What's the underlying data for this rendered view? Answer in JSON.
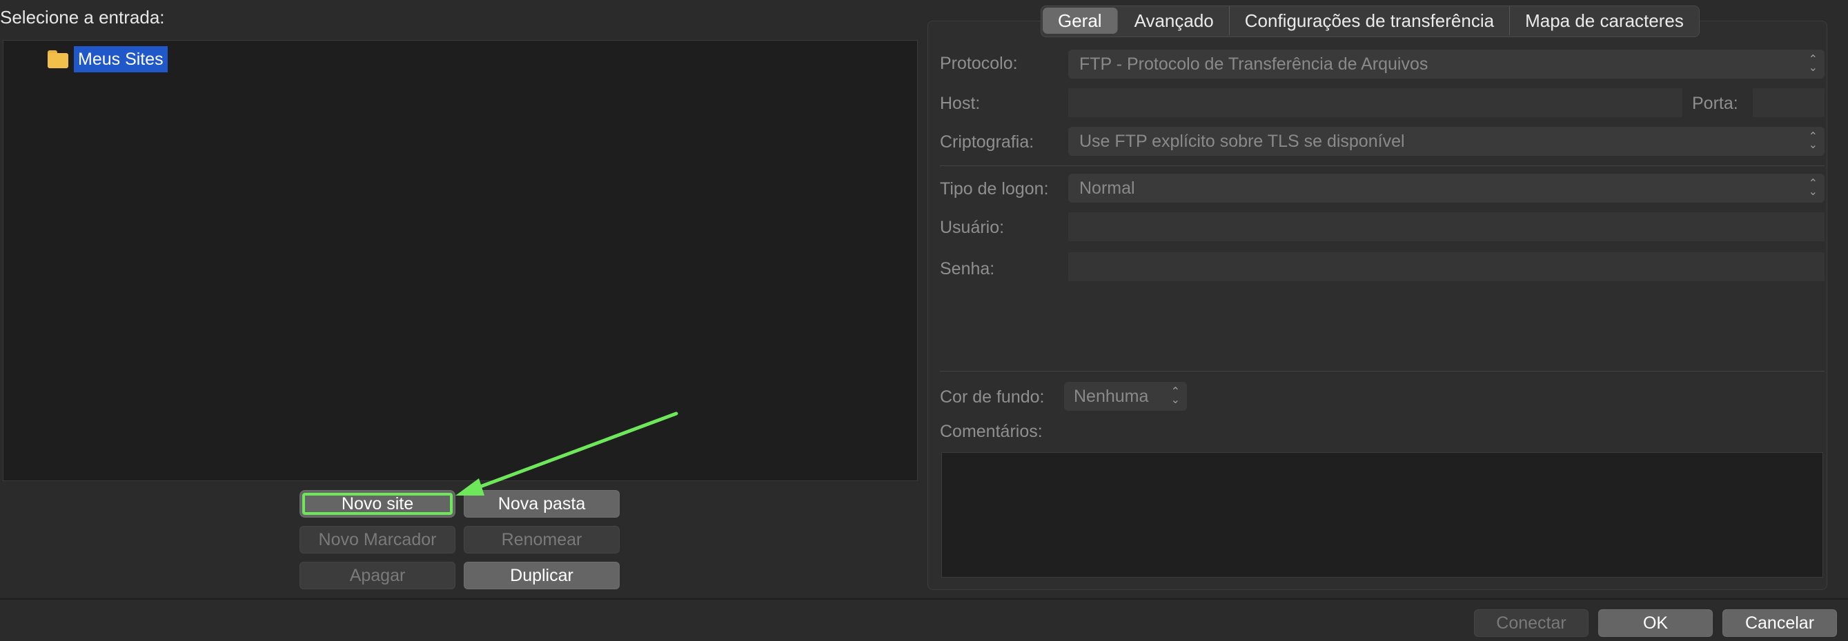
{
  "left": {
    "select_label": "Selecione a entrada:",
    "tree": {
      "items": [
        {
          "label": "Meus Sites",
          "icon": "folder-icon",
          "selected": true
        }
      ]
    },
    "buttons": {
      "new_site": "Novo site",
      "new_folder": "Nova pasta",
      "new_bookmark": "Novo Marcador",
      "rename": "Renomear",
      "delete": "Apagar",
      "duplicate": "Duplicar"
    }
  },
  "tabs": [
    {
      "label": "Geral",
      "active": true
    },
    {
      "label": "Avançado",
      "active": false
    },
    {
      "label": "Configurações de transferência",
      "active": false
    },
    {
      "label": "Mapa de caracteres",
      "active": false
    }
  ],
  "form": {
    "protocol_label": "Protocolo:",
    "protocol_value": "FTP - Protocolo de Transferência de Arquivos",
    "host_label": "Host:",
    "host_value": "",
    "port_label": "Porta:",
    "port_value": "",
    "encryption_label": "Criptografia:",
    "encryption_value": "Use FTP explícito sobre TLS se disponível",
    "logon_label": "Tipo de logon:",
    "logon_value": "Normal",
    "user_label": "Usuário:",
    "user_value": "",
    "password_label": "Senha:",
    "password_value": "",
    "bgcolor_label": "Cor de fundo:",
    "bgcolor_value": "Nenhuma",
    "comments_label": "Comentários:",
    "comments_value": ""
  },
  "footer": {
    "connect": "Conectar",
    "ok": "OK",
    "cancel": "Cancelar"
  },
  "colors": {
    "selection": "#2158c9",
    "highlight_annotation": "#6ee85a",
    "folder": "#f2c04a"
  }
}
